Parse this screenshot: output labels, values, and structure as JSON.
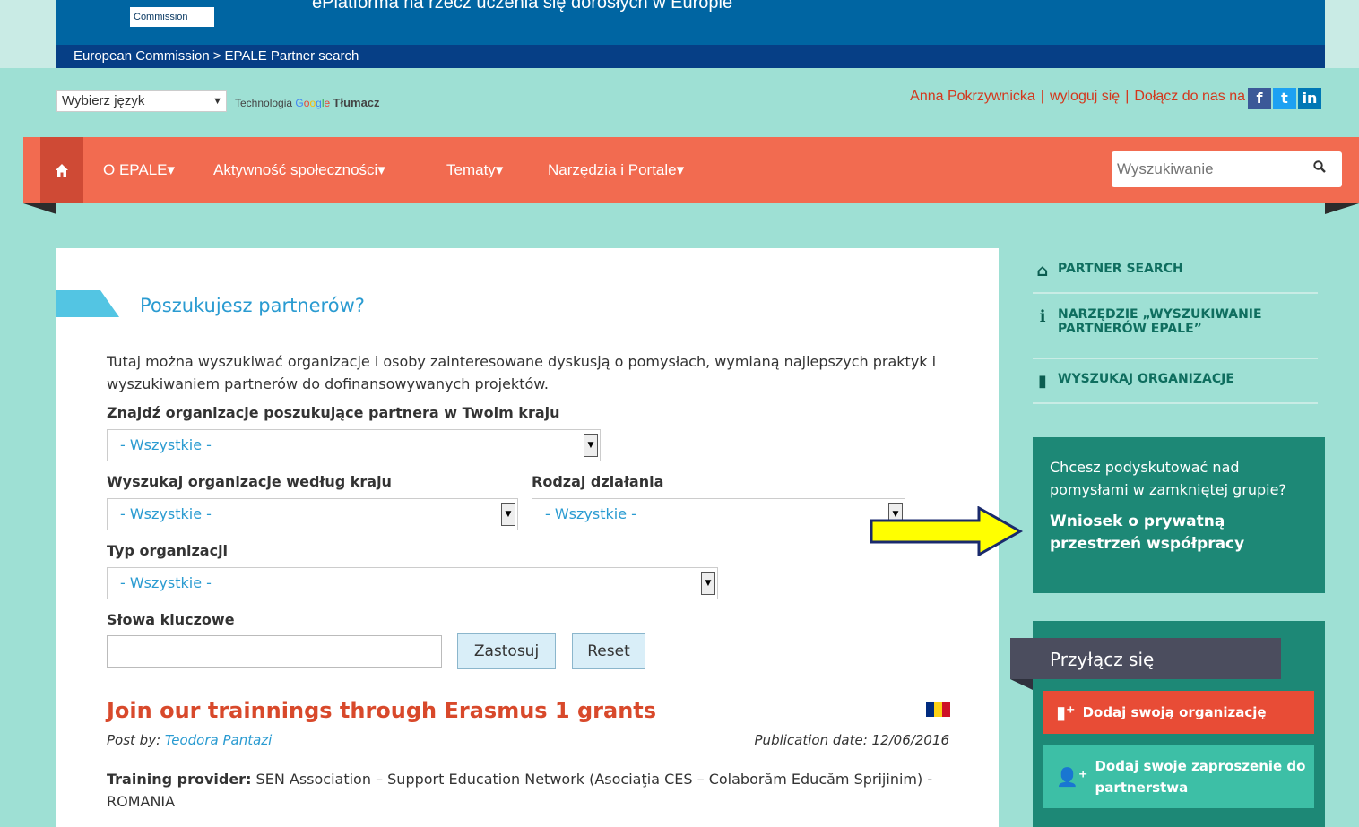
{
  "header": {
    "commission_label": "Commission",
    "tagline": "ePlatforma na rzecz uczenia się dorosłych w Europie",
    "breadcrumb": [
      "European Commission",
      "EPALE Partner search"
    ]
  },
  "language": {
    "select_value": "Wybierz język",
    "powered_by": "Technologia",
    "google_letters": [
      "G",
      "o",
      "o",
      "g",
      "l",
      "e"
    ],
    "translate_label": "Tłumacz"
  },
  "user_bar": {
    "username": "Anna Pokrzywnicka",
    "logout": "wyloguj się",
    "join_us": "Dołącz do nas na",
    "social": [
      "f",
      "t",
      "in"
    ]
  },
  "nav": {
    "home_icon": "home-icon",
    "items": [
      "O EPALE▾",
      "Aktywność społeczności▾",
      "Tematy▾",
      "Narzędzia i Portale▾"
    ],
    "search_placeholder": "Wyszukiwanie"
  },
  "main": {
    "title": "Poszukujesz partnerów?",
    "intro": "Tutaj można wyszukiwać organizacje i osoby zainteresowane dyskusją o pomysłach, wymianą najlepszych praktyk i wyszukiwaniem partnerów do dofinansowywanych projektów.",
    "filters": {
      "country_partner_label": "Znajdź organizacje poszukujące partnera w Twoim kraju",
      "country_partner_value": "- Wszystkie -",
      "org_country_label": "Wyszukaj organizacje według kraju",
      "org_country_value": "- Wszystkie -",
      "activity_label": "Rodzaj działania",
      "activity_value": "- Wszystkie -",
      "org_type_label": "Typ organizacji",
      "org_type_value": "- Wszystkie -",
      "keywords_label": "Słowa kluczowe",
      "keywords_value": "",
      "apply": "Zastosuj",
      "reset": "Reset"
    },
    "post": {
      "title": "Join our trainnings through Erasmus 1 grants",
      "post_by_label": "Post by:",
      "author": "Teodora Pantazi",
      "pub_label": "Publication date:",
      "pub_date": "12/06/2016",
      "provider_label": "Training provider:",
      "provider_text": " SEN Association – Support Education Network (Asociaţia CES – Colaborăm Educăm Sprijinim) - ROMANIA",
      "flag_colors": [
        "#002b7f",
        "#fcd116",
        "#ce1126"
      ]
    }
  },
  "sidebar": {
    "links": [
      {
        "label": "PARTNER SEARCH",
        "icon": "home-icon"
      },
      {
        "label": "NARZĘDZIE „WYSZUKIWANIE PARTNERÓW EPALE”",
        "icon": "info-icon"
      },
      {
        "label": "WYSZUKAJ ORGANIZACJE",
        "icon": "building-icon"
      }
    ],
    "private_box": {
      "question": "Chcesz podyskutować nad pomysłami w zamkniętej grupie?",
      "link": "Wniosek o prywatną przestrzeń współpracy"
    },
    "join": {
      "title": "Przyłącz się",
      "add_org": "Dodaj swoją organizację",
      "add_invite": "Dodaj swoje zaproszenie do partnerstwa"
    }
  },
  "colors": {
    "page_bg": "#9ee0d4",
    "nav_bg": "#f26b50",
    "header_bg": "#0065a2",
    "teal": "#1d8876",
    "accent_red": "#d8492b",
    "link_blue": "#2a9bd1",
    "annotation_arrow": "#ffff00"
  }
}
